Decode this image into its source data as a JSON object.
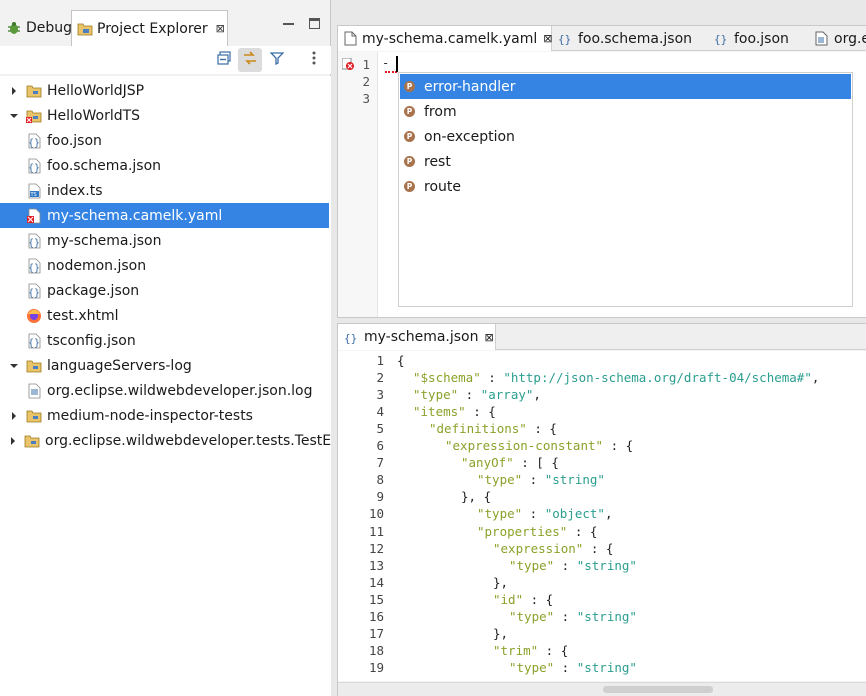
{
  "left_pane": {
    "tabs": [
      {
        "label": "Debug",
        "icon": "debug-bug-icon"
      },
      {
        "label": "Project Explorer",
        "icon": "project-explorer-icon",
        "close": "⊠"
      }
    ],
    "toolbar_icons": [
      "collapse-all-icon",
      "link-with-editor-icon",
      "filter-icon",
      "view-menu-icon"
    ],
    "tree": [
      {
        "label": "HelloWorldJSP",
        "icon": "project-folder-icon",
        "level": 0,
        "expanded": false
      },
      {
        "label": "HelloWorldTS",
        "icon": "project-folder-error-icon",
        "level": 0,
        "expanded": true
      },
      {
        "label": "foo.json",
        "icon": "json-file-icon",
        "level": 1
      },
      {
        "label": "foo.schema.json",
        "icon": "json-file-icon",
        "level": 1
      },
      {
        "label": "index.ts",
        "icon": "ts-file-icon",
        "level": 1
      },
      {
        "label": "my-schema.camelk.yaml",
        "icon": "yaml-file-error-icon",
        "level": 1,
        "selected": true
      },
      {
        "label": "my-schema.json",
        "icon": "json-file-icon",
        "level": 1
      },
      {
        "label": "nodemon.json",
        "icon": "json-file-icon",
        "level": 1
      },
      {
        "label": "package.json",
        "icon": "json-file-icon",
        "level": 1
      },
      {
        "label": "test.xhtml",
        "icon": "firefox-icon",
        "level": 1
      },
      {
        "label": "tsconfig.json",
        "icon": "json-file-icon",
        "level": 1
      },
      {
        "label": "languageServers-log",
        "icon": "project-folder-icon",
        "level": 0,
        "expanded": true
      },
      {
        "label": "org.eclipse.wildwebdeveloper.json.log",
        "icon": "log-file-icon",
        "level": 1
      },
      {
        "label": "medium-node-inspector-tests",
        "icon": "project-folder-icon",
        "level": 0,
        "expanded": false
      },
      {
        "label": "org.eclipse.wildwebdeveloper.tests.TestESL",
        "icon": "project-folder-icon",
        "level": 0,
        "expanded": false
      }
    ]
  },
  "editor_top": {
    "tabs": [
      {
        "label": "my-schema.camelk.yaml",
        "icon": "yaml-file-icon",
        "close": "⊠",
        "active": true
      },
      {
        "label": "foo.schema.json",
        "icon": "json-file-icon"
      },
      {
        "label": "foo.json",
        "icon": "json-file-icon"
      },
      {
        "label": "org.e",
        "icon": "log-file-icon"
      }
    ],
    "line_numbers": [
      "1",
      "2",
      "3"
    ],
    "line1_text": "-",
    "completion_items": [
      {
        "label": "error-handler",
        "badge": "P",
        "selected": true
      },
      {
        "label": "from",
        "badge": "P"
      },
      {
        "label": "on-exception",
        "badge": "P"
      },
      {
        "label": "rest",
        "badge": "P"
      },
      {
        "label": "route",
        "badge": "P"
      }
    ]
  },
  "editor_bottom": {
    "tab": {
      "label": "my-schema.json",
      "icon": "json-file-icon",
      "close": "⊠"
    },
    "lines": [
      {
        "n": "1",
        "indent": 0,
        "parts": [
          [
            "p",
            "{"
          ]
        ]
      },
      {
        "n": "2",
        "indent": 1,
        "parts": [
          [
            "k",
            "\"$schema\""
          ],
          [
            "p",
            " : "
          ],
          [
            "s",
            "\"http://json-schema.org/draft-04/schema#\""
          ],
          [
            "p",
            ","
          ]
        ]
      },
      {
        "n": "3",
        "indent": 1,
        "parts": [
          [
            "k",
            "\"type\""
          ],
          [
            "p",
            " : "
          ],
          [
            "s",
            "\"array\""
          ],
          [
            "p",
            ","
          ]
        ]
      },
      {
        "n": "4",
        "indent": 1,
        "parts": [
          [
            "k",
            "\"items\""
          ],
          [
            "p",
            " : {"
          ]
        ]
      },
      {
        "n": "5",
        "indent": 2,
        "parts": [
          [
            "k",
            "\"definitions\""
          ],
          [
            "p",
            " : {"
          ]
        ]
      },
      {
        "n": "6",
        "indent": 3,
        "parts": [
          [
            "k",
            "\"expression-constant\""
          ],
          [
            "p",
            " : {"
          ]
        ]
      },
      {
        "n": "7",
        "indent": 4,
        "parts": [
          [
            "k",
            "\"anyOf\""
          ],
          [
            "p",
            " : [ {"
          ]
        ]
      },
      {
        "n": "8",
        "indent": 5,
        "parts": [
          [
            "k",
            "\"type\""
          ],
          [
            "p",
            " : "
          ],
          [
            "s",
            "\"string\""
          ]
        ]
      },
      {
        "n": "9",
        "indent": 4,
        "parts": [
          [
            "p",
            "}, {"
          ]
        ]
      },
      {
        "n": "10",
        "indent": 5,
        "parts": [
          [
            "k",
            "\"type\""
          ],
          [
            "p",
            " : "
          ],
          [
            "s",
            "\"object\""
          ],
          [
            "p",
            ","
          ]
        ]
      },
      {
        "n": "11",
        "indent": 5,
        "parts": [
          [
            "k",
            "\"properties\""
          ],
          [
            "p",
            " : {"
          ]
        ]
      },
      {
        "n": "12",
        "indent": 6,
        "parts": [
          [
            "k",
            "\"expression\""
          ],
          [
            "p",
            " : {"
          ]
        ]
      },
      {
        "n": "13",
        "indent": 7,
        "parts": [
          [
            "k",
            "\"type\""
          ],
          [
            "p",
            " : "
          ],
          [
            "s",
            "\"string\""
          ]
        ]
      },
      {
        "n": "14",
        "indent": 6,
        "parts": [
          [
            "p",
            "},"
          ]
        ]
      },
      {
        "n": "15",
        "indent": 6,
        "parts": [
          [
            "k",
            "\"id\""
          ],
          [
            "p",
            " : {"
          ]
        ]
      },
      {
        "n": "16",
        "indent": 7,
        "parts": [
          [
            "k",
            "\"type\""
          ],
          [
            "p",
            " : "
          ],
          [
            "s",
            "\"string\""
          ]
        ]
      },
      {
        "n": "17",
        "indent": 6,
        "parts": [
          [
            "p",
            "},"
          ]
        ]
      },
      {
        "n": "18",
        "indent": 6,
        "parts": [
          [
            "k",
            "\"trim\""
          ],
          [
            "p",
            " : {"
          ]
        ]
      },
      {
        "n": "19",
        "indent": 7,
        "parts": [
          [
            "k",
            "\"type\""
          ],
          [
            "p",
            " : "
          ],
          [
            "s",
            "\"string\""
          ]
        ]
      }
    ]
  },
  "colors": {
    "selection": "#3584e4",
    "json_key": "#8aa22a",
    "json_string": "#2a9e8f",
    "error": "#e01b24",
    "property_badge": "#a8734d"
  }
}
